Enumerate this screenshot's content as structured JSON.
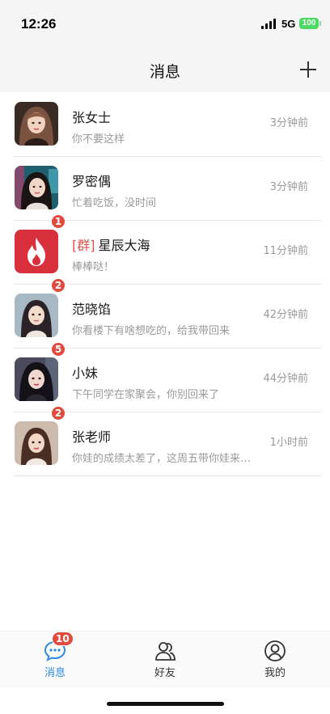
{
  "status_bar": {
    "time": "12:26",
    "network": "5G",
    "battery": "100"
  },
  "header": {
    "title": "消息",
    "add_icon": "plus-icon"
  },
  "conversations": [
    {
      "name": "张女士",
      "group_tag": "",
      "preview": "你不要这样",
      "time": "3分钟前",
      "badge": "",
      "avatar_color": "#6b4a3e"
    },
    {
      "name": "罗密偶",
      "group_tag": "",
      "preview": "忙着吃饭，没时间",
      "time": "3分钟前",
      "badge": "",
      "avatar_color": "#2d7f8c"
    },
    {
      "name": "星辰大海",
      "group_tag": "[群]",
      "preview": "棒棒哒！",
      "time": "11分钟前",
      "badge": "1",
      "avatar_color": "#d9303e"
    },
    {
      "name": "范晓馅",
      "group_tag": "",
      "preview": "你看楼下有啥想吃的，给我带回来",
      "time": "42分钟前",
      "badge": "2",
      "avatar_color": "#9fb2bf"
    },
    {
      "name": "小妹",
      "group_tag": "",
      "preview": "下午同学在家聚会，你别回来了",
      "time": "44分钟前",
      "badge": "5",
      "avatar_color": "#3b3a4a"
    },
    {
      "name": "张老师",
      "group_tag": "",
      "preview": "你娃的成绩太差了，这周五带你娃来…",
      "time": "1小时前",
      "badge": "2",
      "avatar_color": "#c9b6a9"
    }
  ],
  "tab_bar": {
    "tabs": [
      {
        "label": "消息",
        "icon": "chat-bubble-icon",
        "active": true,
        "badge": "10"
      },
      {
        "label": "好友",
        "icon": "friends-icon",
        "active": false,
        "badge": ""
      },
      {
        "label": "我的",
        "icon": "profile-icon",
        "active": false,
        "badge": ""
      }
    ]
  },
  "colors": {
    "accent": "#2f8ae5",
    "badge": "#e04b3f",
    "group_tag": "#d9534f"
  }
}
